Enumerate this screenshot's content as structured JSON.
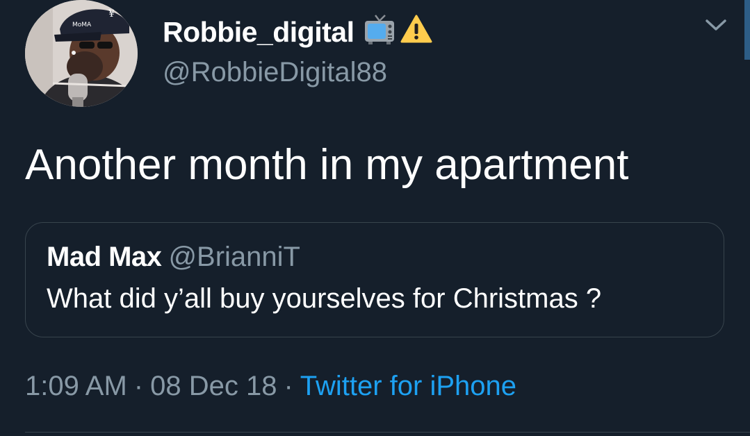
{
  "author": {
    "display_name": "Robbie_digital",
    "name_emoji_tv": "📺",
    "name_emoji_warning": "⚠",
    "handle": "@RobbieDigital88",
    "avatar_icon": "profile-photo",
    "cap_text": "MoMA"
  },
  "tweet": {
    "text": "Another month in my apartment"
  },
  "quoted_tweet": {
    "author_name": "Mad Max",
    "author_handle": "@BrianniT",
    "text": "What did y’all buy yourselves for Christmas ?"
  },
  "meta": {
    "time": "1:09 AM",
    "separator": "·",
    "date": "08 Dec 18",
    "source": "Twitter for iPhone"
  },
  "icons": {
    "menu": "chevron-down-icon"
  },
  "colors": {
    "background": "#151f2b",
    "text": "#ffffff",
    "secondary_text": "#8899a6",
    "link": "#1da1f2",
    "border": "#38444d"
  }
}
